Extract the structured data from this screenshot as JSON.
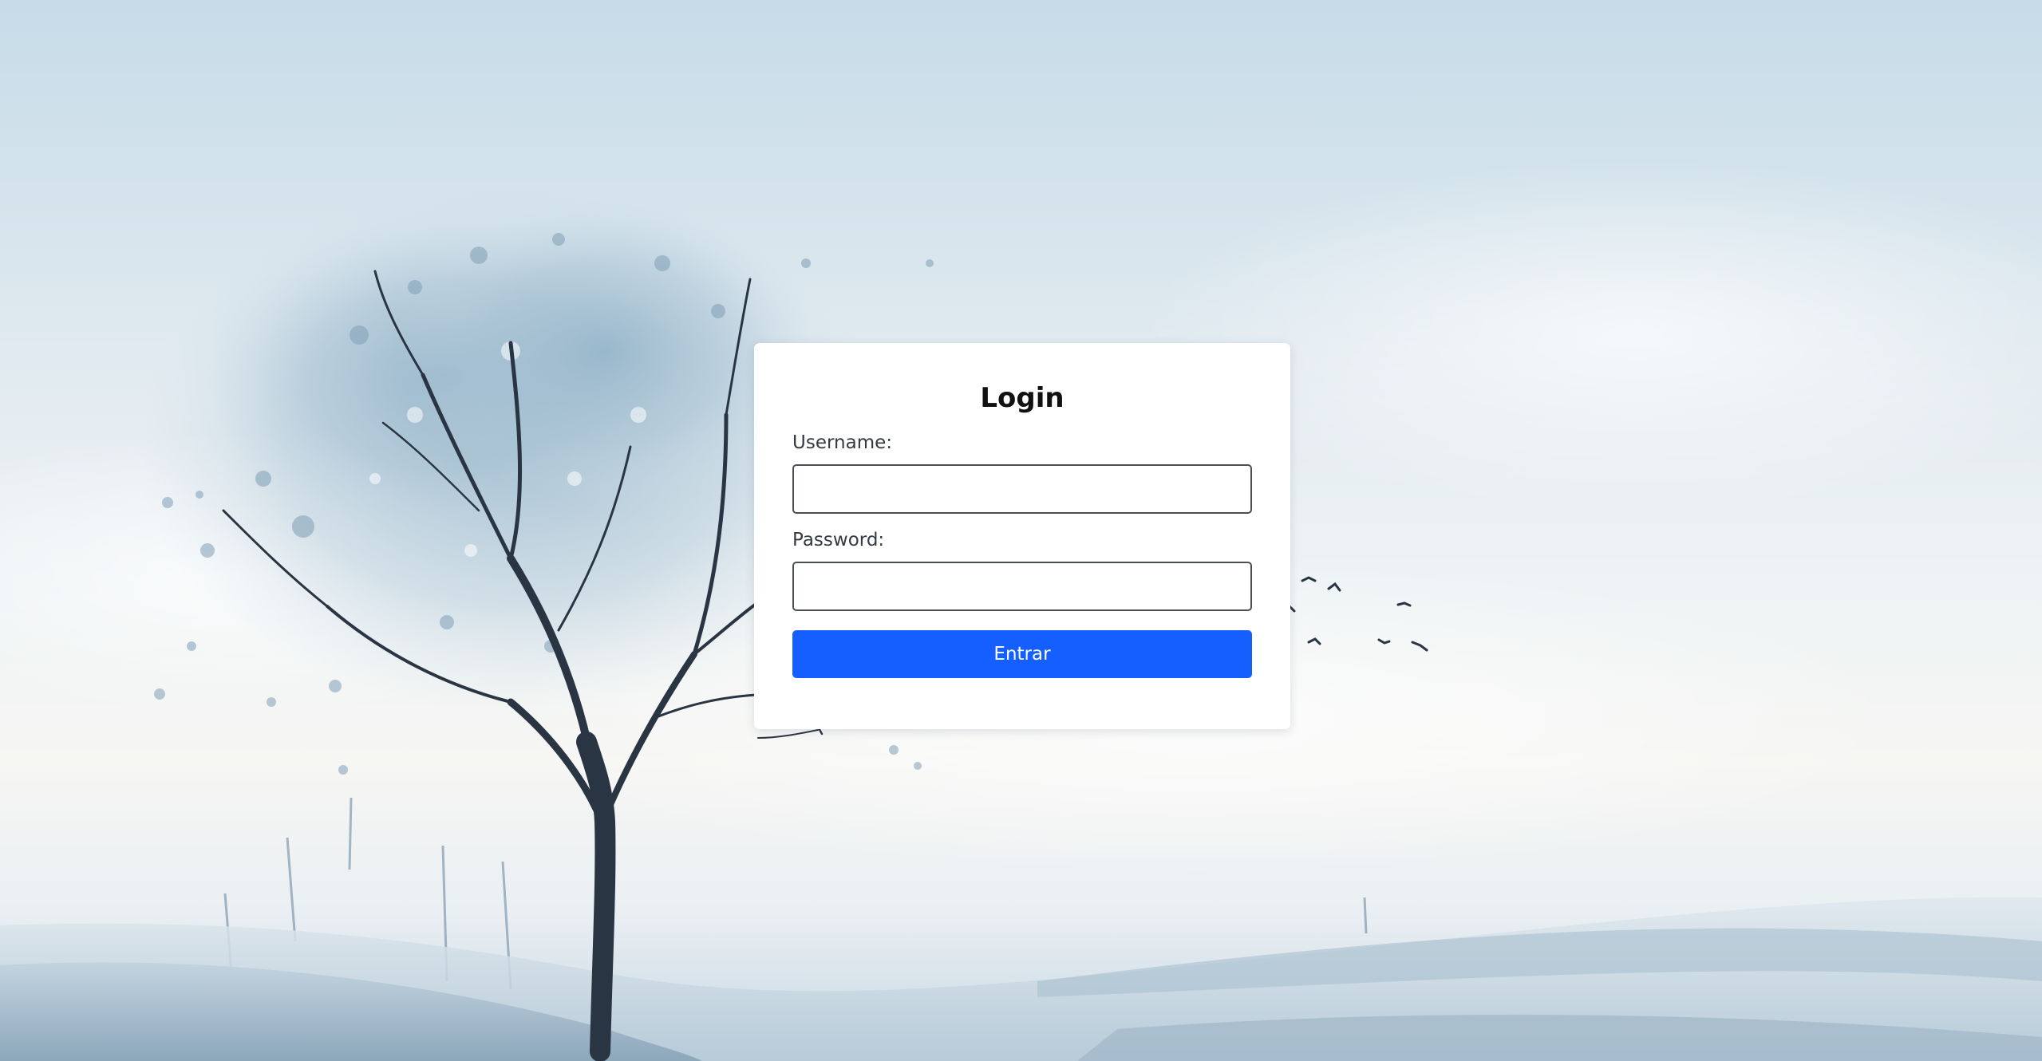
{
  "login": {
    "title": "Login",
    "username_label": "Username:",
    "username_value": "",
    "password_label": "Password:",
    "password_value": "",
    "submit_label": "Entrar"
  },
  "colors": {
    "primary_button": "#155eff",
    "card_background": "#ffffff",
    "input_border": "#4a4f55"
  },
  "background": {
    "description_icon": "winter-tree-landscape-illustration"
  }
}
